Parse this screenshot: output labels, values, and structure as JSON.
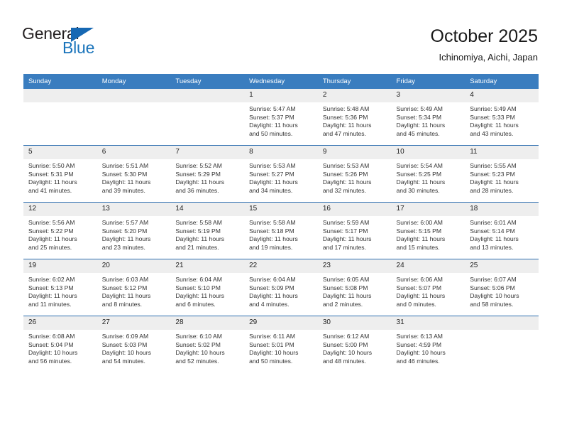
{
  "brand": {
    "name_part1": "General",
    "name_part2": "Blue",
    "triangle_color": "#1668b3",
    "blue_color": "#1a74bb"
  },
  "header": {
    "title": "October 2025",
    "location": "Ichinomiya, Aichi, Japan"
  },
  "theme": {
    "header_bg": "#3a7dbf",
    "row_divider": "#2e6fb0",
    "daynum_bg": "#eeeeee"
  },
  "weekdays": [
    "Sunday",
    "Monday",
    "Tuesday",
    "Wednesday",
    "Thursday",
    "Friday",
    "Saturday"
  ],
  "weeks": [
    [
      {
        "day": "",
        "sunrise": "",
        "sunset": "",
        "daylight1": "",
        "daylight2": "",
        "empty": true
      },
      {
        "day": "",
        "sunrise": "",
        "sunset": "",
        "daylight1": "",
        "daylight2": "",
        "empty": true
      },
      {
        "day": "",
        "sunrise": "",
        "sunset": "",
        "daylight1": "",
        "daylight2": "",
        "empty": true
      },
      {
        "day": "1",
        "sunrise": "Sunrise: 5:47 AM",
        "sunset": "Sunset: 5:37 PM",
        "daylight1": "Daylight: 11 hours",
        "daylight2": "and 50 minutes."
      },
      {
        "day": "2",
        "sunrise": "Sunrise: 5:48 AM",
        "sunset": "Sunset: 5:36 PM",
        "daylight1": "Daylight: 11 hours",
        "daylight2": "and 47 minutes."
      },
      {
        "day": "3",
        "sunrise": "Sunrise: 5:49 AM",
        "sunset": "Sunset: 5:34 PM",
        "daylight1": "Daylight: 11 hours",
        "daylight2": "and 45 minutes."
      },
      {
        "day": "4",
        "sunrise": "Sunrise: 5:49 AM",
        "sunset": "Sunset: 5:33 PM",
        "daylight1": "Daylight: 11 hours",
        "daylight2": "and 43 minutes."
      }
    ],
    [
      {
        "day": "5",
        "sunrise": "Sunrise: 5:50 AM",
        "sunset": "Sunset: 5:31 PM",
        "daylight1": "Daylight: 11 hours",
        "daylight2": "and 41 minutes."
      },
      {
        "day": "6",
        "sunrise": "Sunrise: 5:51 AM",
        "sunset": "Sunset: 5:30 PM",
        "daylight1": "Daylight: 11 hours",
        "daylight2": "and 39 minutes."
      },
      {
        "day": "7",
        "sunrise": "Sunrise: 5:52 AM",
        "sunset": "Sunset: 5:29 PM",
        "daylight1": "Daylight: 11 hours",
        "daylight2": "and 36 minutes."
      },
      {
        "day": "8",
        "sunrise": "Sunrise: 5:53 AM",
        "sunset": "Sunset: 5:27 PM",
        "daylight1": "Daylight: 11 hours",
        "daylight2": "and 34 minutes."
      },
      {
        "day": "9",
        "sunrise": "Sunrise: 5:53 AM",
        "sunset": "Sunset: 5:26 PM",
        "daylight1": "Daylight: 11 hours",
        "daylight2": "and 32 minutes."
      },
      {
        "day": "10",
        "sunrise": "Sunrise: 5:54 AM",
        "sunset": "Sunset: 5:25 PM",
        "daylight1": "Daylight: 11 hours",
        "daylight2": "and 30 minutes."
      },
      {
        "day": "11",
        "sunrise": "Sunrise: 5:55 AM",
        "sunset": "Sunset: 5:23 PM",
        "daylight1": "Daylight: 11 hours",
        "daylight2": "and 28 minutes."
      }
    ],
    [
      {
        "day": "12",
        "sunrise": "Sunrise: 5:56 AM",
        "sunset": "Sunset: 5:22 PM",
        "daylight1": "Daylight: 11 hours",
        "daylight2": "and 25 minutes."
      },
      {
        "day": "13",
        "sunrise": "Sunrise: 5:57 AM",
        "sunset": "Sunset: 5:20 PM",
        "daylight1": "Daylight: 11 hours",
        "daylight2": "and 23 minutes."
      },
      {
        "day": "14",
        "sunrise": "Sunrise: 5:58 AM",
        "sunset": "Sunset: 5:19 PM",
        "daylight1": "Daylight: 11 hours",
        "daylight2": "and 21 minutes."
      },
      {
        "day": "15",
        "sunrise": "Sunrise: 5:58 AM",
        "sunset": "Sunset: 5:18 PM",
        "daylight1": "Daylight: 11 hours",
        "daylight2": "and 19 minutes."
      },
      {
        "day": "16",
        "sunrise": "Sunrise: 5:59 AM",
        "sunset": "Sunset: 5:17 PM",
        "daylight1": "Daylight: 11 hours",
        "daylight2": "and 17 minutes."
      },
      {
        "day": "17",
        "sunrise": "Sunrise: 6:00 AM",
        "sunset": "Sunset: 5:15 PM",
        "daylight1": "Daylight: 11 hours",
        "daylight2": "and 15 minutes."
      },
      {
        "day": "18",
        "sunrise": "Sunrise: 6:01 AM",
        "sunset": "Sunset: 5:14 PM",
        "daylight1": "Daylight: 11 hours",
        "daylight2": "and 13 minutes."
      }
    ],
    [
      {
        "day": "19",
        "sunrise": "Sunrise: 6:02 AM",
        "sunset": "Sunset: 5:13 PM",
        "daylight1": "Daylight: 11 hours",
        "daylight2": "and 11 minutes."
      },
      {
        "day": "20",
        "sunrise": "Sunrise: 6:03 AM",
        "sunset": "Sunset: 5:12 PM",
        "daylight1": "Daylight: 11 hours",
        "daylight2": "and 8 minutes."
      },
      {
        "day": "21",
        "sunrise": "Sunrise: 6:04 AM",
        "sunset": "Sunset: 5:10 PM",
        "daylight1": "Daylight: 11 hours",
        "daylight2": "and 6 minutes."
      },
      {
        "day": "22",
        "sunrise": "Sunrise: 6:04 AM",
        "sunset": "Sunset: 5:09 PM",
        "daylight1": "Daylight: 11 hours",
        "daylight2": "and 4 minutes."
      },
      {
        "day": "23",
        "sunrise": "Sunrise: 6:05 AM",
        "sunset": "Sunset: 5:08 PM",
        "daylight1": "Daylight: 11 hours",
        "daylight2": "and 2 minutes."
      },
      {
        "day": "24",
        "sunrise": "Sunrise: 6:06 AM",
        "sunset": "Sunset: 5:07 PM",
        "daylight1": "Daylight: 11 hours",
        "daylight2": "and 0 minutes."
      },
      {
        "day": "25",
        "sunrise": "Sunrise: 6:07 AM",
        "sunset": "Sunset: 5:06 PM",
        "daylight1": "Daylight: 10 hours",
        "daylight2": "and 58 minutes."
      }
    ],
    [
      {
        "day": "26",
        "sunrise": "Sunrise: 6:08 AM",
        "sunset": "Sunset: 5:04 PM",
        "daylight1": "Daylight: 10 hours",
        "daylight2": "and 56 minutes."
      },
      {
        "day": "27",
        "sunrise": "Sunrise: 6:09 AM",
        "sunset": "Sunset: 5:03 PM",
        "daylight1": "Daylight: 10 hours",
        "daylight2": "and 54 minutes."
      },
      {
        "day": "28",
        "sunrise": "Sunrise: 6:10 AM",
        "sunset": "Sunset: 5:02 PM",
        "daylight1": "Daylight: 10 hours",
        "daylight2": "and 52 minutes."
      },
      {
        "day": "29",
        "sunrise": "Sunrise: 6:11 AM",
        "sunset": "Sunset: 5:01 PM",
        "daylight1": "Daylight: 10 hours",
        "daylight2": "and 50 minutes."
      },
      {
        "day": "30",
        "sunrise": "Sunrise: 6:12 AM",
        "sunset": "Sunset: 5:00 PM",
        "daylight1": "Daylight: 10 hours",
        "daylight2": "and 48 minutes."
      },
      {
        "day": "31",
        "sunrise": "Sunrise: 6:13 AM",
        "sunset": "Sunset: 4:59 PM",
        "daylight1": "Daylight: 10 hours",
        "daylight2": "and 46 minutes."
      },
      {
        "day": "",
        "sunrise": "",
        "sunset": "",
        "daylight1": "",
        "daylight2": "",
        "empty": true
      }
    ]
  ]
}
